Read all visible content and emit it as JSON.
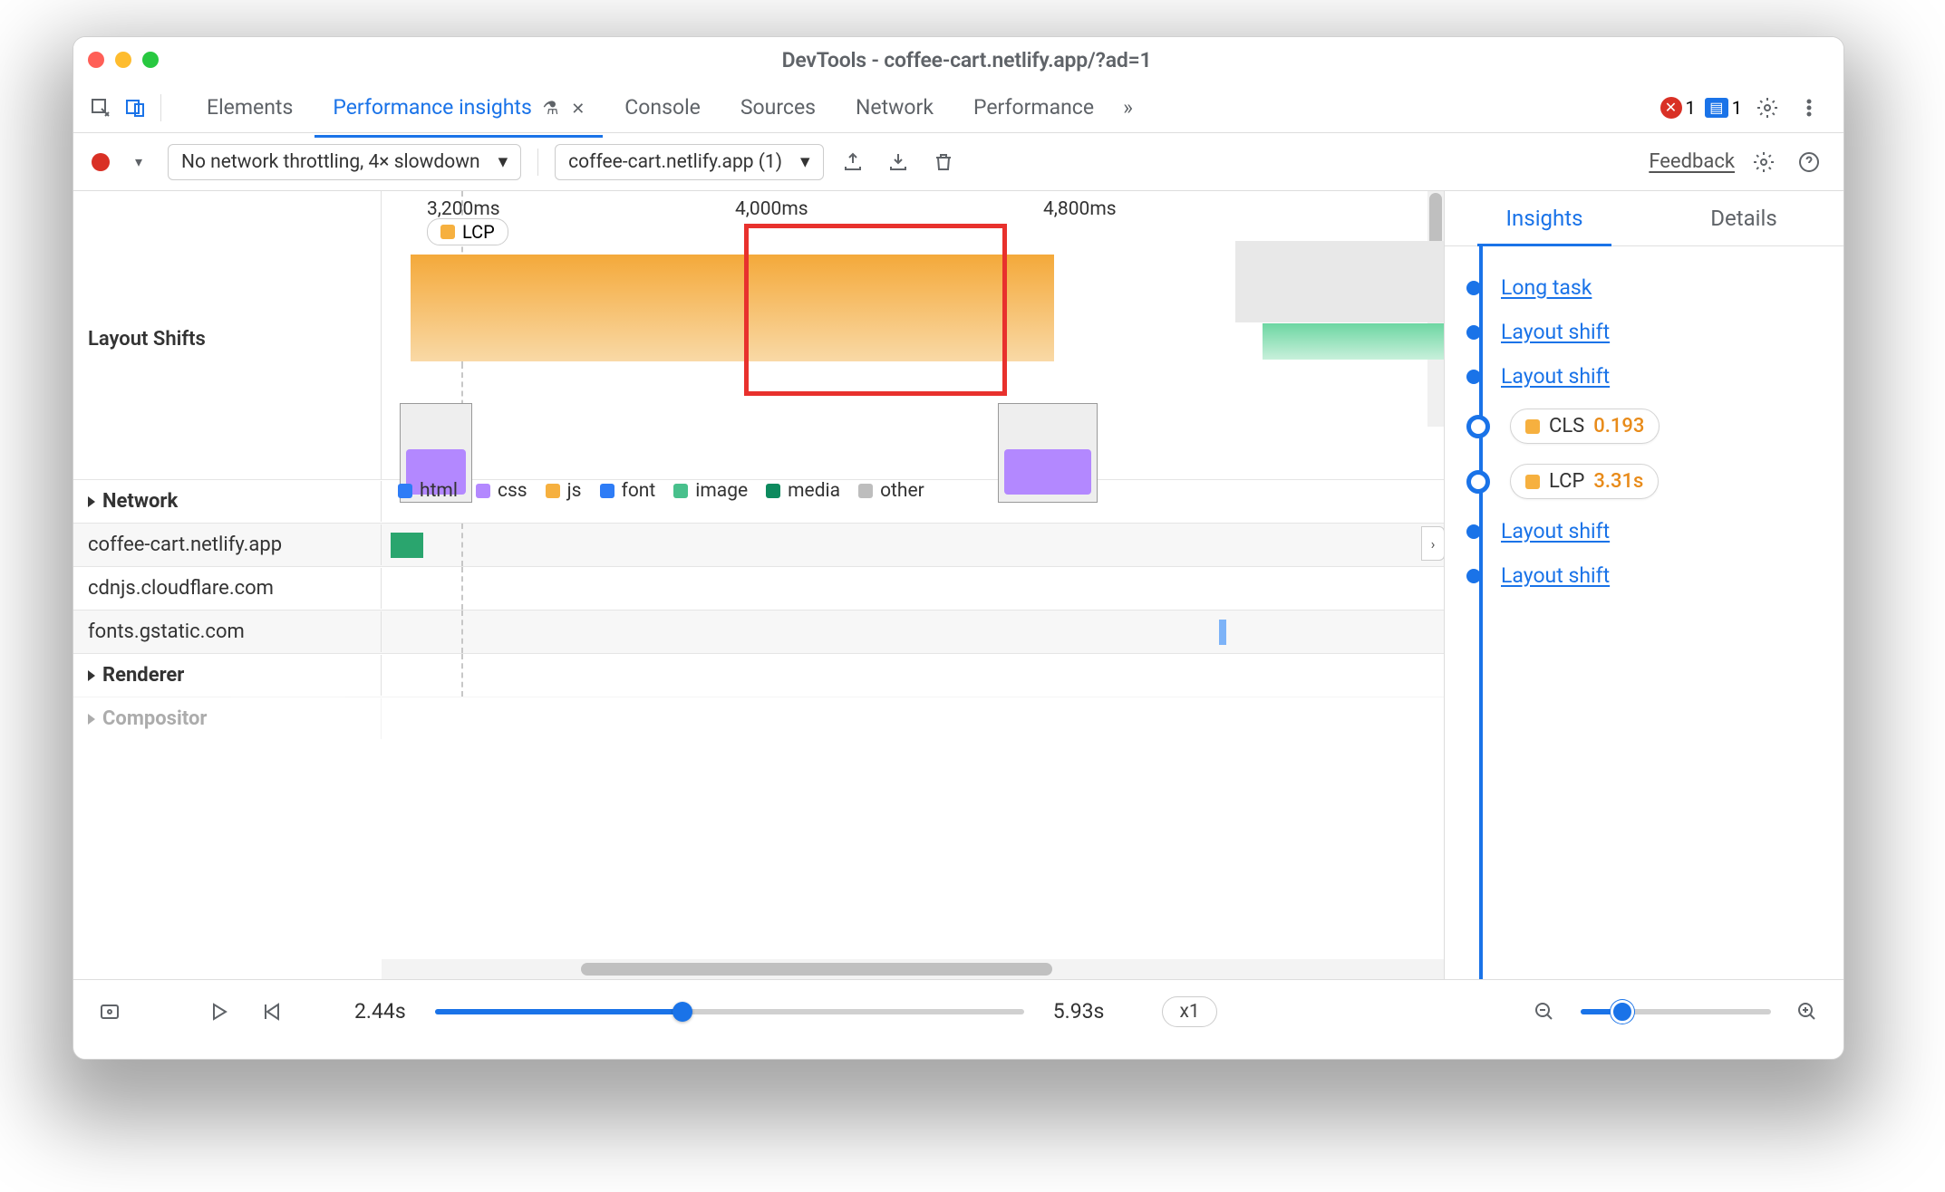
{
  "window": {
    "title": "DevTools - coffee-cart.netlify.app/?ad=1"
  },
  "tabs": {
    "items": [
      "Elements",
      "Performance insights",
      "Console",
      "Sources",
      "Network",
      "Performance"
    ],
    "active": "Performance insights",
    "overflow": "»",
    "close": "✕",
    "errors": {
      "icon": "✕",
      "count": "1"
    },
    "messages": {
      "icon": "▤",
      "count": "1"
    }
  },
  "toolbar": {
    "throttling": "No network throttling, 4× slowdown",
    "recording": "coffee-cart.netlify.app (1)",
    "feedback": "Feedback"
  },
  "timeline": {
    "ticks": [
      "3,200ms",
      "4,000ms",
      "4,800ms"
    ],
    "lcp_pill": "LCP",
    "section_layout_shifts": "Layout Shifts",
    "network": {
      "header": "Network",
      "legend": [
        "html",
        "css",
        "js",
        "font",
        "image",
        "media",
        "other"
      ],
      "rows": [
        "coffee-cart.netlify.app",
        "cdnjs.cloudflare.com",
        "fonts.gstatic.com"
      ]
    },
    "renderer": "Renderer",
    "compositor": "Compositor"
  },
  "insights": {
    "tabs": {
      "insights": "Insights",
      "details": "Details"
    },
    "items": [
      {
        "type": "link",
        "label": "Long task"
      },
      {
        "type": "link",
        "label": "Layout shift"
      },
      {
        "type": "link",
        "label": "Layout shift"
      },
      {
        "type": "metric",
        "icon": "orange",
        "name": "CLS",
        "value": "0.193"
      },
      {
        "type": "metric",
        "icon": "orange",
        "name": "LCP",
        "value": "3.31s"
      },
      {
        "type": "link",
        "label": "Layout shift"
      },
      {
        "type": "link",
        "label": "Layout shift"
      }
    ]
  },
  "footer": {
    "start": "2.44s",
    "end": "5.93s",
    "speed": "x1"
  }
}
